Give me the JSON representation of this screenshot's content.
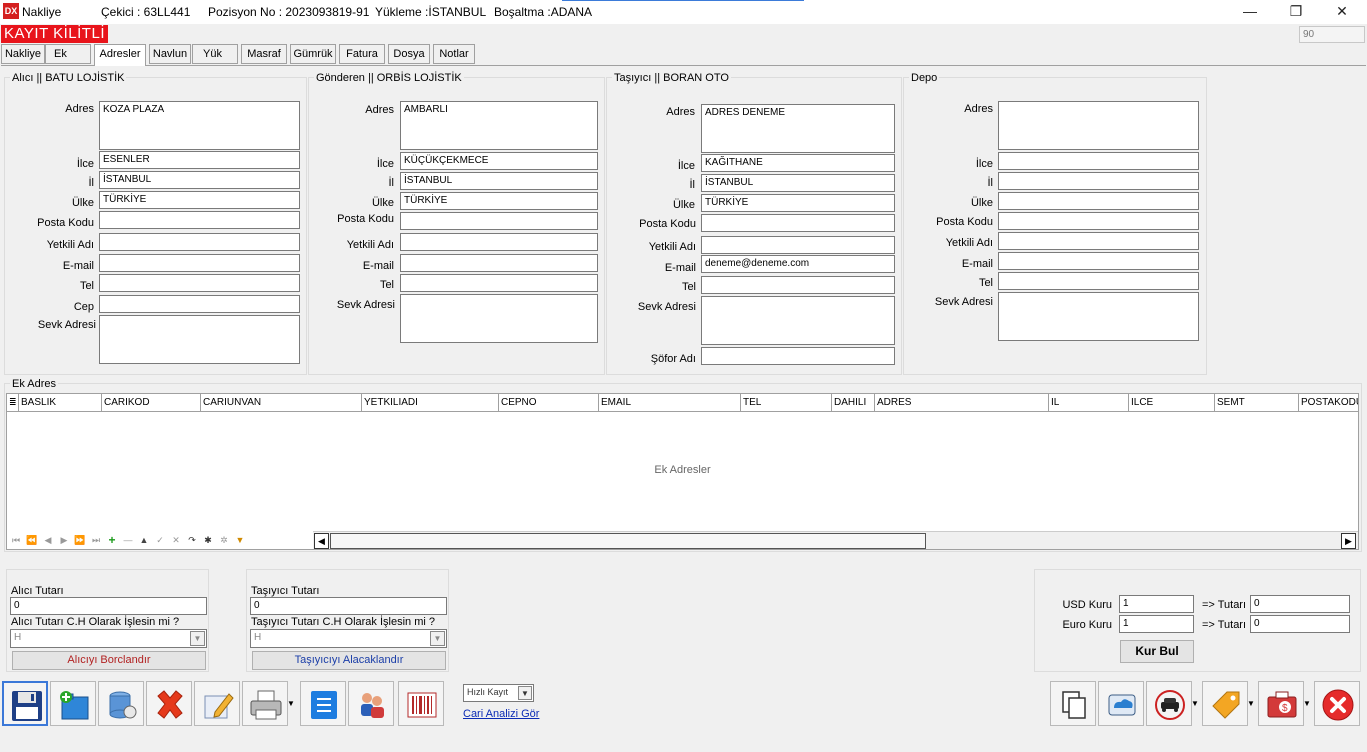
{
  "titlebar": {
    "app_name": "Nakliye",
    "cekici": "Çekici  : 63LL441",
    "pozisyon": "Pozisyon No : 2023093819-91",
    "yukleme": "Yükleme :İSTANBUL",
    "bosaltma": "Boşaltma :ADANA",
    "minimize": "—",
    "restore": "❐",
    "close": "✕"
  },
  "status": {
    "locked": "KAYIT KİLİTLİ",
    "counter": "90"
  },
  "tabs": [
    "Nakliye",
    "Ek",
    "Adresler",
    "Navlun",
    "Yük",
    "Masraf",
    "Gümrük",
    "Fatura",
    "Dosya",
    "Notlar"
  ],
  "labels": {
    "adres": "Adres",
    "ilce": "İlce",
    "il": "İl",
    "ulke": "Ülke",
    "posta_kodu": "Posta Kodu",
    "yetkili_adi": "Yetkili Adı",
    "email": "E-mail",
    "tel": "Tel",
    "cep": "Cep",
    "sevk_adresi": "Sevk Adresi",
    "sofor_adi": "Şöfor Adı"
  },
  "alici": {
    "title": "Alıcı  ||  BATU LOJİSTİK",
    "adres": "KOZA PLAZA",
    "ilce": "ESENLER",
    "il": "İSTANBUL",
    "ulke": "TÜRKİYE",
    "posta_kodu": "",
    "yetkili_adi": "",
    "email": "",
    "tel": "",
    "cep": "",
    "sevk_adresi": ""
  },
  "gonderen": {
    "title": "Gönderen  ||  ORBİS LOJİSTİK",
    "adres": "AMBARLI",
    "ilce": "KÜÇÜKÇEKMECE",
    "il": "İSTANBUL",
    "ulke": "TÜRKİYE",
    "posta_kodu": "",
    "yetkili_adi": "",
    "email": "",
    "tel": "",
    "sevk_adresi": ""
  },
  "tasiyici": {
    "title": "Taşıyıcı  ||  BORAN OTO",
    "adres": "ADRES DENEME",
    "ilce": "KAĞITHANE",
    "il": "İSTANBUL",
    "ulke": "TÜRKİYE",
    "posta_kodu": "",
    "yetkili_adi": "",
    "email": "deneme@deneme.com",
    "tel": "",
    "sevk_adresi": "",
    "sofor_adi": ""
  },
  "depo": {
    "title": "Depo",
    "adres": "",
    "ilce": "",
    "il": "",
    "ulke": "",
    "posta_kodu": "",
    "yetkili_adi": "",
    "email": "",
    "tel": "",
    "sevk_adresi": ""
  },
  "ek_adres": {
    "title": "Ek Adres",
    "columns": [
      "BASLIK",
      "CARIKOD",
      "CARIUNVAN",
      "YETKILIADI",
      "CEPNO",
      "EMAIL",
      "TEL",
      "DAHILI",
      "ADRES",
      "IL",
      "ILCE",
      "SEMT",
      "POSTAKODU"
    ],
    "empty_text": "Ek Adresler",
    "nav": [
      "⏮",
      "⏪",
      "◀",
      "▶",
      "⏩",
      "⏭",
      "+",
      "—",
      "▲",
      "✓",
      "✕",
      "↷",
      "✱",
      "✲",
      "▼"
    ]
  },
  "alici_tutar": {
    "label": "Alıcı Tutarı",
    "value": "0",
    "ch_label": "Alıcı Tutarı C.H Olarak İşlesin mi ?",
    "ch_value": "H",
    "button": "Alıcıyı Borclandır"
  },
  "tasiyici_tutar": {
    "label": "Taşıyıcı Tutarı",
    "value": "0",
    "ch_label": "Taşıyıcı Tutarı C.H Olarak İşlesin mi ?",
    "ch_value": "H",
    "button": "Taşıyıcıyı Alacaklandır"
  },
  "kur": {
    "usd_label": "USD Kuru",
    "usd_value": "1",
    "euro_label": "Euro Kuru",
    "euro_value": "1",
    "tutar_label": "=> Tutarı",
    "usd_tutar": "0",
    "euro_tutar": "0",
    "button": "Kur Bul"
  },
  "toolbar": {
    "hizli_kayit": "Hızlı Kayıt",
    "cari_analizi": "Cari Analizi Gör"
  },
  "colors": {
    "accent_red": "#e8141b",
    "link_blue": "#0b2bb5",
    "button_text_red": "#b22222",
    "button_text_blue": "#1b3ea8"
  }
}
